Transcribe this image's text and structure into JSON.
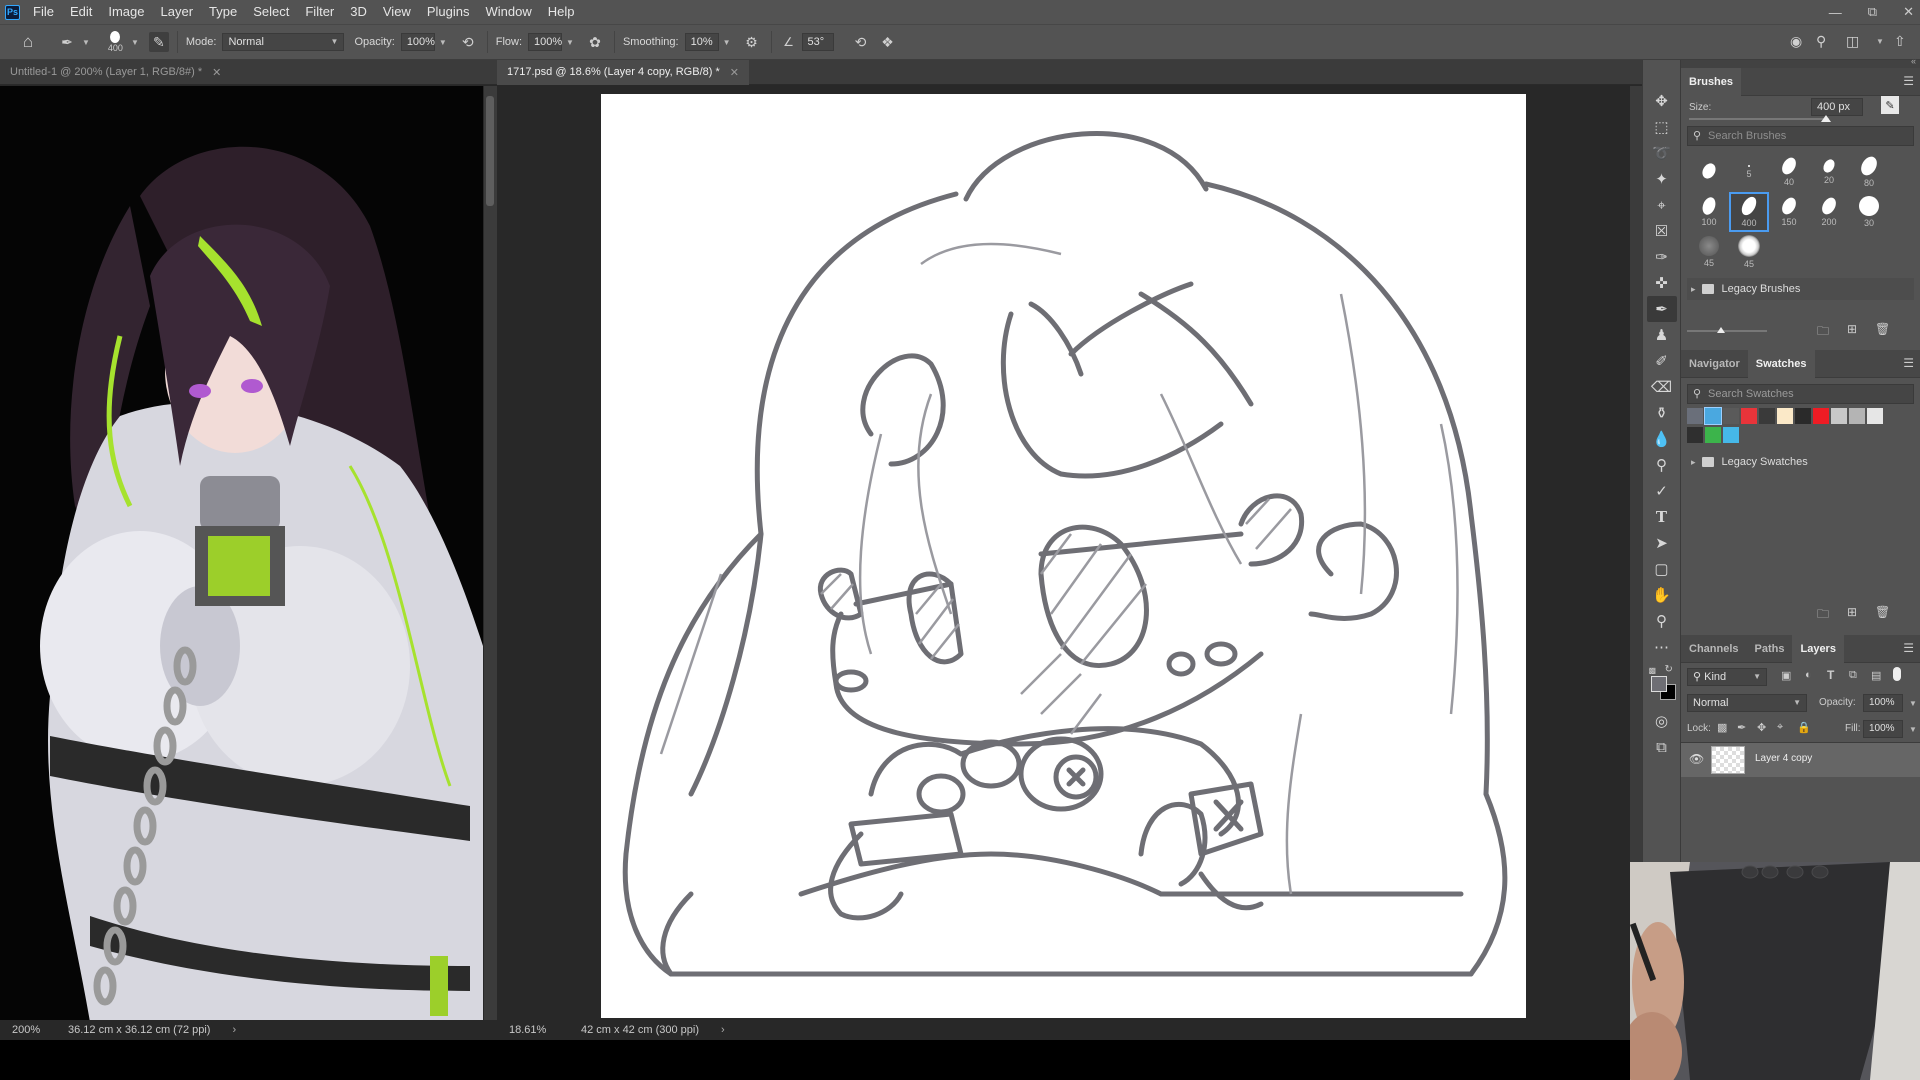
{
  "menubar": {
    "logo": "Ps",
    "items": [
      "File",
      "Edit",
      "Image",
      "Layer",
      "Type",
      "Select",
      "Filter",
      "3D",
      "View",
      "Plugins",
      "Window",
      "Help"
    ]
  },
  "options": {
    "brush_size": "400",
    "mode_label": "Mode:",
    "mode_value": "Normal",
    "opacity_label": "Opacity:",
    "opacity_value": "100%",
    "flow_label": "Flow:",
    "flow_value": "100%",
    "smoothing_label": "Smoothing:",
    "smoothing_value": "10%",
    "angle_value": "53°"
  },
  "doc_left": {
    "tab_title": "Untitled-1 @ 200% (Layer 1, RGB/8#) *",
    "status_zoom": "200%",
    "status_info": "36.12 cm x 36.12 cm (72 ppi)"
  },
  "doc_center": {
    "tab_title": "1717.psd @ 18.6% (Layer 4 copy, RGB/8) *",
    "status_zoom": "18.61%",
    "status_info": "42 cm x 42 cm (300 ppi)"
  },
  "brushes_panel": {
    "title": "Brushes",
    "size_label": "Size:",
    "size_value": "400 px",
    "search_placeholder": "Search Brushes",
    "presets": [
      {
        "size": ""
      },
      {
        "size": "5"
      },
      {
        "size": "40"
      },
      {
        "size": "20"
      },
      {
        "size": "80"
      },
      {
        "size": "100"
      },
      {
        "size": "400"
      },
      {
        "size": "150"
      },
      {
        "size": "200"
      },
      {
        "size": "30"
      },
      {
        "size": "45"
      },
      {
        "size": "45"
      }
    ],
    "folder": "Legacy Brushes"
  },
  "swatches_panel": {
    "tabs": [
      "Navigator",
      "Swatches"
    ],
    "search_placeholder": "Search Swatches",
    "colors_row1": [
      "#6a6f7a",
      "#4aa8e0",
      "#5a5a5a",
      "#e8343a",
      "#3a3a3a",
      "#fbe9c8",
      "#2a2a2a",
      "#ee1c24",
      "#c8c8c8",
      "#b4b4b4",
      "#e6e6e6"
    ],
    "colors_row2": [
      "#2f2f2f",
      "#3cb44b",
      "#46b8e8"
    ],
    "folder": "Legacy Swatches"
  },
  "layers_panel": {
    "tabs": [
      "Channels",
      "Paths",
      "Layers"
    ],
    "kind_label": "Kind",
    "blend_mode": "Normal",
    "opacity_label": "Opacity:",
    "opacity_value": "100%",
    "lock_label": "Lock:",
    "fill_label": "Fill:",
    "fill_value": "100%",
    "layer_name": "Layer 4 copy"
  }
}
